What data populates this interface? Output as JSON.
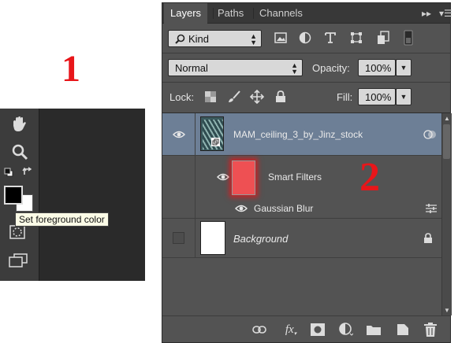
{
  "callouts": {
    "one": "1",
    "two": "2"
  },
  "tools_panel": {
    "tooltip": "Set foreground color",
    "icons": [
      "hand-icon",
      "zoom-icon",
      "default-colors-icon",
      "swap-colors-icon",
      "foreground-swatch",
      "background-swatch",
      "quick-mask-icon",
      "screen-mode-icon"
    ],
    "foreground_color": "#000000",
    "background_color": "#ffffff"
  },
  "layers_panel": {
    "tabs": [
      {
        "label": "Layers",
        "active": true
      },
      {
        "label": "Paths",
        "active": false
      },
      {
        "label": "Channels",
        "active": false
      }
    ],
    "menu_icons": [
      "collapse-icon",
      "panel-menu-icon"
    ],
    "filter": {
      "label": "Kind",
      "icons": [
        "pixel-filter-icon",
        "adjustment-filter-icon",
        "type-filter-icon",
        "shape-filter-icon",
        "smart-object-filter-icon",
        "filter-toggle-icon"
      ]
    },
    "blend_mode": "Normal",
    "opacity": {
      "label": "Opacity:",
      "value": "100%"
    },
    "lock": {
      "label": "Lock:",
      "icons": [
        "lock-transparent-icon",
        "lock-pixels-icon",
        "lock-position-icon",
        "lock-all-icon"
      ]
    },
    "fill": {
      "label": "Fill:",
      "value": "100%"
    },
    "layers": [
      {
        "name": "MAM_ceiling_3_by_Jinz_stock",
        "visible": true,
        "selected": true,
        "type": "smart-object"
      },
      {
        "name": "Smart Filters",
        "visible": true,
        "type": "smart-filters-mask"
      },
      {
        "name": "Gaussian Blur",
        "visible": true,
        "type": "filter"
      },
      {
        "name": "Background",
        "visible": false,
        "locked": true,
        "type": "background"
      }
    ],
    "bottom_icons": [
      "link-layers-icon",
      "fx-icon",
      "add-mask-icon",
      "adjustment-layer-icon",
      "new-group-icon",
      "new-layer-icon",
      "delete-layer-icon"
    ],
    "bottom_fx_label": "fx"
  },
  "colors": {
    "panel_bg": "#535353",
    "selected_row": "#6d7f96",
    "highlight_red": "#e8161a"
  }
}
